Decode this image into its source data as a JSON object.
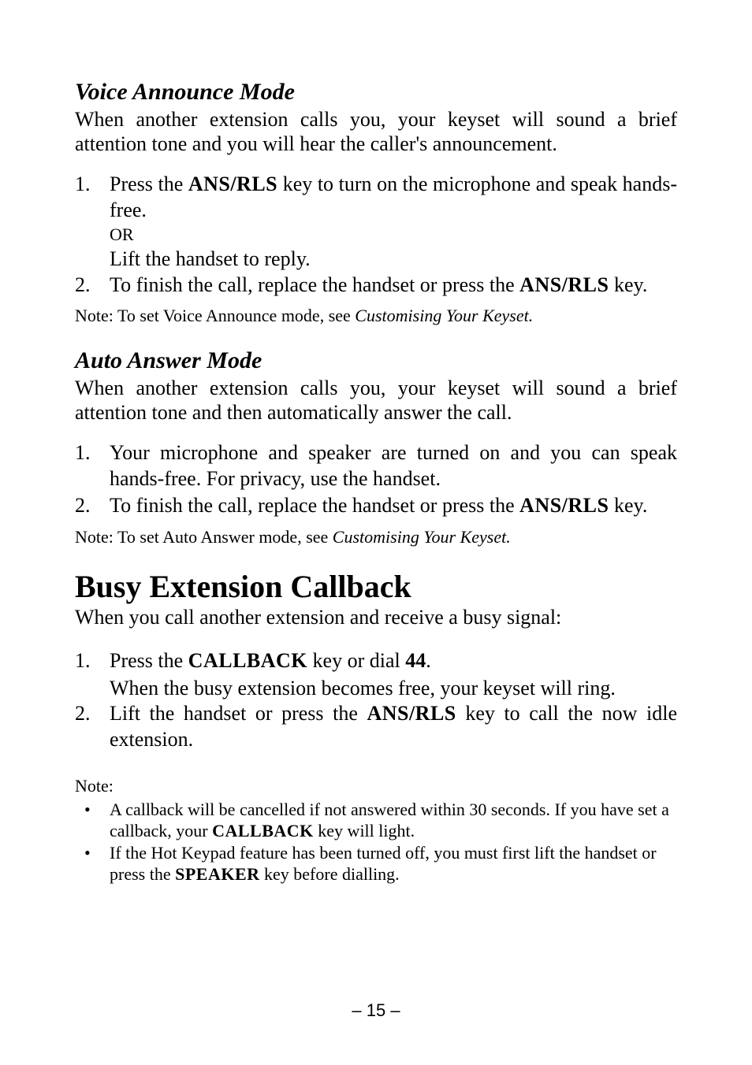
{
  "section1": {
    "heading": "Voice Announce Mode",
    "intro": "When another extension calls you, your keyset will sound a brief attention tone and you will hear the caller's announcement.",
    "list": [
      {
        "num": "1.",
        "text_pre": "Press the ",
        "key": "ANS/RLS",
        "text_post": " key to turn on the microphone and speak hands-free."
      },
      {
        "num": "2.",
        "text_pre": "To finish the call, replace the handset or press the ",
        "key": "ANS/RLS",
        "text_post": " key."
      }
    ],
    "or": "OR",
    "lift": "Lift the handset to reply.",
    "note_pre": "Note: To set Voice Announce mode, see ",
    "note_em": "Customising Your Keyset."
  },
  "section2": {
    "heading": "Auto Answer Mode",
    "intro": "When another extension calls you, your keyset will sound a brief attention tone and then automatically answer the call.",
    "list": [
      {
        "num": "1.",
        "text": "Your microphone and speaker are turned on and you can speak hands-free. For privacy, use the handset."
      },
      {
        "num": "2.",
        "text_pre": "To finish the call, replace the handset or press the ",
        "key": "ANS/RLS",
        "text_post": " key."
      }
    ],
    "note_pre": "Note: To set Auto Answer mode, see ",
    "note_em": "Customising Your Keyset."
  },
  "section3": {
    "heading": "Busy Extension Callback",
    "intro": "When you call another extension and receive a busy signal:",
    "list": [
      {
        "num": "1.",
        "text_pre": "Press the ",
        "key": "CALLBACK",
        "text_mid": " key or dial ",
        "bold": "44",
        "text_post": "."
      },
      {
        "num": "2.",
        "text_pre": "Lift the handset or press the ",
        "key": "ANS/RLS",
        "text_post": " key to call the now idle extension."
      }
    ],
    "sub1": "When the busy extension becomes free, your keyset will ring.",
    "note_label": "Note:",
    "bullets": [
      {
        "pre": "A callback will be cancelled if not answered within 30 seconds. If you have set a callback, your ",
        "key": "CALLBACK",
        "post": " key will light."
      },
      {
        "pre": "If the Hot Keypad feature has been turned off, you must first lift the handset or press the ",
        "key": "SPEAKER",
        "post": " key before dialling."
      }
    ]
  },
  "page": "– 15 –"
}
